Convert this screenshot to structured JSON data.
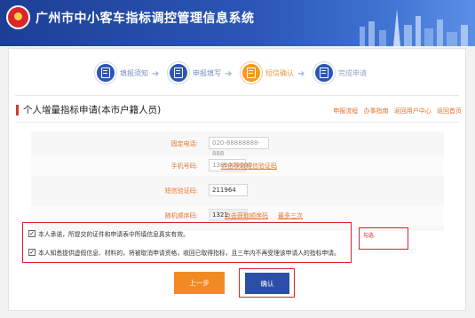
{
  "header": {
    "title": "广州市中小客车指标调控管理信息系统"
  },
  "steps": [
    {
      "label": "填报须知",
      "state": "done",
      "icon": "document-icon"
    },
    {
      "label": "申报填写",
      "state": "done",
      "icon": "edit-icon"
    },
    {
      "label": "短信确认",
      "state": "current",
      "icon": "message-icon"
    },
    {
      "label": "完成申请",
      "state": "pending",
      "icon": "check-document-icon"
    }
  ],
  "section": {
    "title": "个人增量指标申请(本市户籍人员)",
    "links": [
      "申报流程",
      "办事指南",
      "返回用户中心",
      "返回首页"
    ]
  },
  "form": {
    "phone_label": "固定电话:",
    "phone_value": "020-88888888-888",
    "mobile_label": "手机号码:",
    "mobile_value": "1380000000",
    "mobile_link": "点击获取短信验证码",
    "sms_label": "短信验证码:",
    "sms_value": "211964",
    "random_label": "随机顺序码:",
    "random_value": "1321",
    "random_link": "点击获取顺序码",
    "random_link2": "最多三次"
  },
  "agreement": {
    "line1": "本人承诺，所提交的证件和申请表中所填信息真实有效。",
    "line2": "本人知悉提供虚假信息、材料的，将被取消申请资格，收回已取得指标，且三年内不再受理该申请人的指标申请。",
    "note": "勾选"
  },
  "buttons": {
    "prev": "上一步",
    "confirm": "确认"
  }
}
